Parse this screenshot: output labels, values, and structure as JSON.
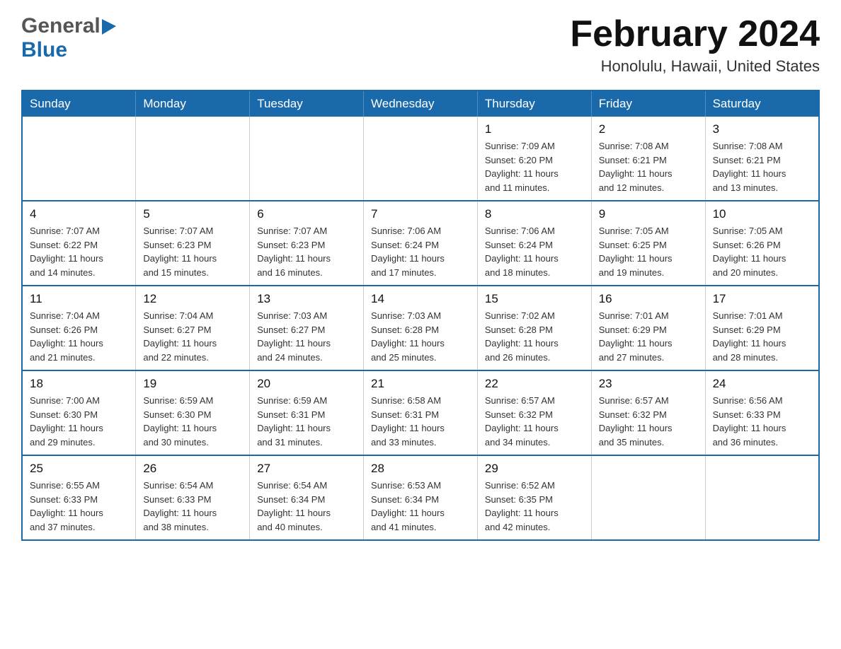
{
  "header": {
    "logo": {
      "general": "General",
      "blue": "Blue"
    },
    "title": "February 2024",
    "location": "Honolulu, Hawaii, United States"
  },
  "calendar": {
    "weekdays": [
      "Sunday",
      "Monday",
      "Tuesday",
      "Wednesday",
      "Thursday",
      "Friday",
      "Saturday"
    ],
    "weeks": [
      [
        {
          "day": "",
          "info": ""
        },
        {
          "day": "",
          "info": ""
        },
        {
          "day": "",
          "info": ""
        },
        {
          "day": "",
          "info": ""
        },
        {
          "day": "1",
          "info": "Sunrise: 7:09 AM\nSunset: 6:20 PM\nDaylight: 11 hours\nand 11 minutes."
        },
        {
          "day": "2",
          "info": "Sunrise: 7:08 AM\nSunset: 6:21 PM\nDaylight: 11 hours\nand 12 minutes."
        },
        {
          "day": "3",
          "info": "Sunrise: 7:08 AM\nSunset: 6:21 PM\nDaylight: 11 hours\nand 13 minutes."
        }
      ],
      [
        {
          "day": "4",
          "info": "Sunrise: 7:07 AM\nSunset: 6:22 PM\nDaylight: 11 hours\nand 14 minutes."
        },
        {
          "day": "5",
          "info": "Sunrise: 7:07 AM\nSunset: 6:23 PM\nDaylight: 11 hours\nand 15 minutes."
        },
        {
          "day": "6",
          "info": "Sunrise: 7:07 AM\nSunset: 6:23 PM\nDaylight: 11 hours\nand 16 minutes."
        },
        {
          "day": "7",
          "info": "Sunrise: 7:06 AM\nSunset: 6:24 PM\nDaylight: 11 hours\nand 17 minutes."
        },
        {
          "day": "8",
          "info": "Sunrise: 7:06 AM\nSunset: 6:24 PM\nDaylight: 11 hours\nand 18 minutes."
        },
        {
          "day": "9",
          "info": "Sunrise: 7:05 AM\nSunset: 6:25 PM\nDaylight: 11 hours\nand 19 minutes."
        },
        {
          "day": "10",
          "info": "Sunrise: 7:05 AM\nSunset: 6:26 PM\nDaylight: 11 hours\nand 20 minutes."
        }
      ],
      [
        {
          "day": "11",
          "info": "Sunrise: 7:04 AM\nSunset: 6:26 PM\nDaylight: 11 hours\nand 21 minutes."
        },
        {
          "day": "12",
          "info": "Sunrise: 7:04 AM\nSunset: 6:27 PM\nDaylight: 11 hours\nand 22 minutes."
        },
        {
          "day": "13",
          "info": "Sunrise: 7:03 AM\nSunset: 6:27 PM\nDaylight: 11 hours\nand 24 minutes."
        },
        {
          "day": "14",
          "info": "Sunrise: 7:03 AM\nSunset: 6:28 PM\nDaylight: 11 hours\nand 25 minutes."
        },
        {
          "day": "15",
          "info": "Sunrise: 7:02 AM\nSunset: 6:28 PM\nDaylight: 11 hours\nand 26 minutes."
        },
        {
          "day": "16",
          "info": "Sunrise: 7:01 AM\nSunset: 6:29 PM\nDaylight: 11 hours\nand 27 minutes."
        },
        {
          "day": "17",
          "info": "Sunrise: 7:01 AM\nSunset: 6:29 PM\nDaylight: 11 hours\nand 28 minutes."
        }
      ],
      [
        {
          "day": "18",
          "info": "Sunrise: 7:00 AM\nSunset: 6:30 PM\nDaylight: 11 hours\nand 29 minutes."
        },
        {
          "day": "19",
          "info": "Sunrise: 6:59 AM\nSunset: 6:30 PM\nDaylight: 11 hours\nand 30 minutes."
        },
        {
          "day": "20",
          "info": "Sunrise: 6:59 AM\nSunset: 6:31 PM\nDaylight: 11 hours\nand 31 minutes."
        },
        {
          "day": "21",
          "info": "Sunrise: 6:58 AM\nSunset: 6:31 PM\nDaylight: 11 hours\nand 33 minutes."
        },
        {
          "day": "22",
          "info": "Sunrise: 6:57 AM\nSunset: 6:32 PM\nDaylight: 11 hours\nand 34 minutes."
        },
        {
          "day": "23",
          "info": "Sunrise: 6:57 AM\nSunset: 6:32 PM\nDaylight: 11 hours\nand 35 minutes."
        },
        {
          "day": "24",
          "info": "Sunrise: 6:56 AM\nSunset: 6:33 PM\nDaylight: 11 hours\nand 36 minutes."
        }
      ],
      [
        {
          "day": "25",
          "info": "Sunrise: 6:55 AM\nSunset: 6:33 PM\nDaylight: 11 hours\nand 37 minutes."
        },
        {
          "day": "26",
          "info": "Sunrise: 6:54 AM\nSunset: 6:33 PM\nDaylight: 11 hours\nand 38 minutes."
        },
        {
          "day": "27",
          "info": "Sunrise: 6:54 AM\nSunset: 6:34 PM\nDaylight: 11 hours\nand 40 minutes."
        },
        {
          "day": "28",
          "info": "Sunrise: 6:53 AM\nSunset: 6:34 PM\nDaylight: 11 hours\nand 41 minutes."
        },
        {
          "day": "29",
          "info": "Sunrise: 6:52 AM\nSunset: 6:35 PM\nDaylight: 11 hours\nand 42 minutes."
        },
        {
          "day": "",
          "info": ""
        },
        {
          "day": "",
          "info": ""
        }
      ]
    ]
  }
}
